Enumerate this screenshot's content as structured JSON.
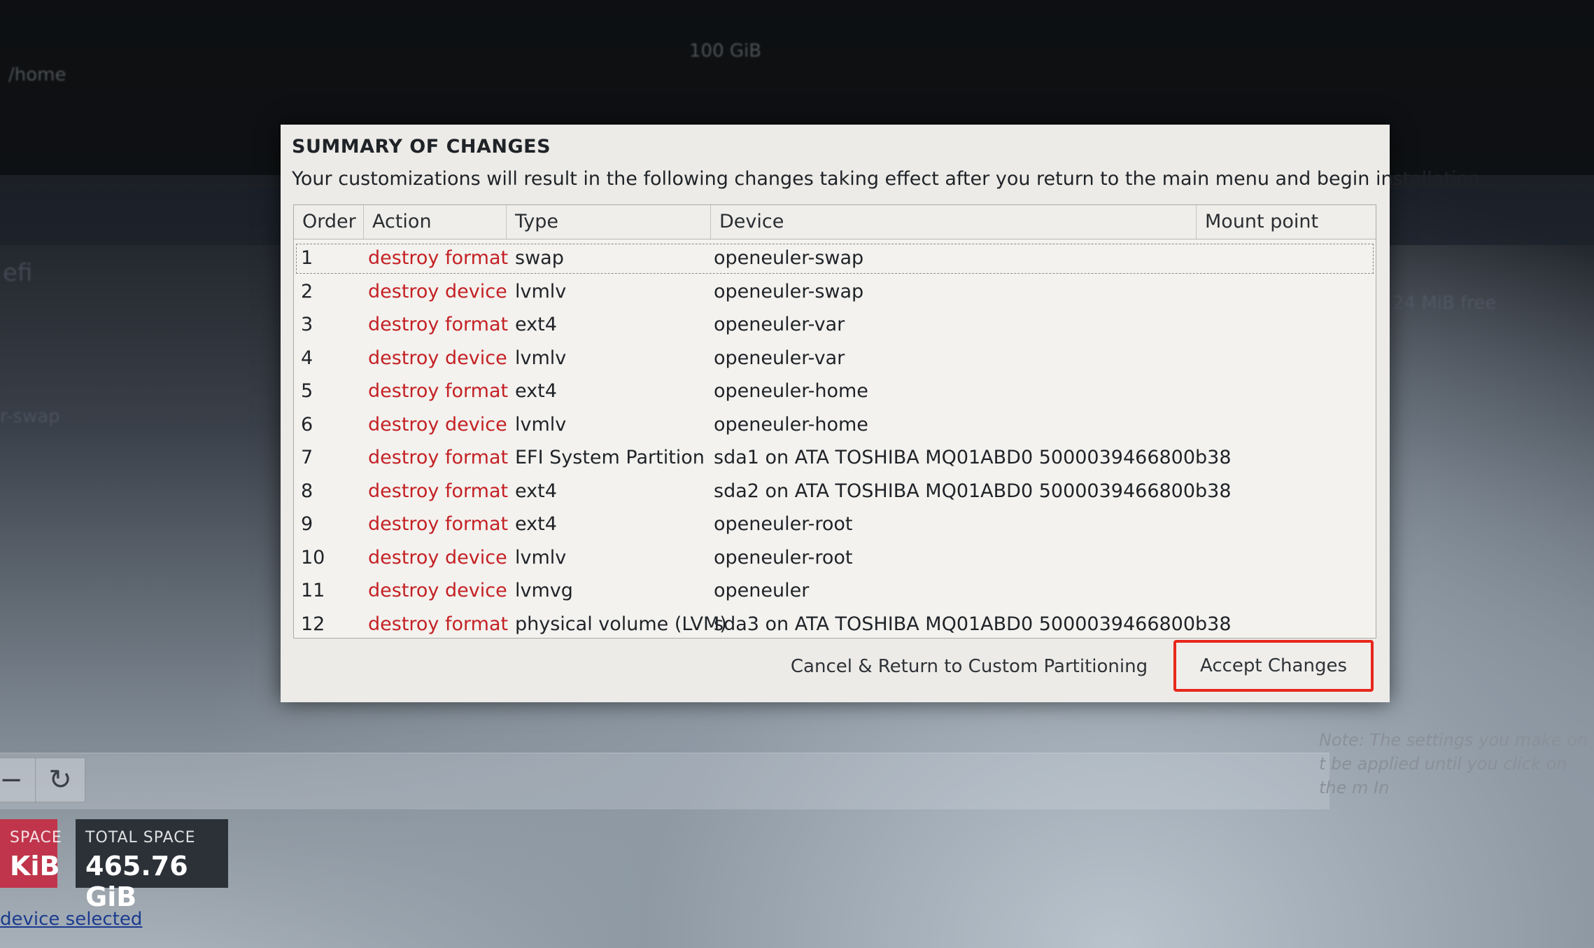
{
  "background": {
    "blurred_home": "/home",
    "blurred_size": "100 GiB",
    "blurred_efi": "efi",
    "blurred_swap": "r-swap",
    "blurred_free": "24 MiB free",
    "note": "Note:  The settings you make on t be applied until you click on the m In",
    "refresh_icon": "refresh-icon",
    "available_space": {
      "label": "SPACE",
      "value": "KiB",
      "color": "#c0354b"
    },
    "total_space": {
      "label": "TOTAL SPACE",
      "value": "465.76 GiB",
      "color": "#2c3138"
    },
    "device_link": "device selected"
  },
  "dialog": {
    "title": "SUMMARY OF CHANGES",
    "description": "Your customizations will result in the following changes taking effect after you return to the main menu and begin installation:",
    "columns": {
      "order": "Order",
      "action": "Action",
      "type": "Type",
      "device": "Device",
      "mount_point": "Mount point"
    },
    "rows": [
      {
        "order": "1",
        "action": "destroy format",
        "type": "swap",
        "device": "openeuler-swap",
        "mount_point": ""
      },
      {
        "order": "2",
        "action": "destroy device",
        "type": "lvmlv",
        "device": "openeuler-swap",
        "mount_point": ""
      },
      {
        "order": "3",
        "action": "destroy format",
        "type": "ext4",
        "device": "openeuler-var",
        "mount_point": ""
      },
      {
        "order": "4",
        "action": "destroy device",
        "type": "lvmlv",
        "device": "openeuler-var",
        "mount_point": ""
      },
      {
        "order": "5",
        "action": "destroy format",
        "type": "ext4",
        "device": "openeuler-home",
        "mount_point": ""
      },
      {
        "order": "6",
        "action": "destroy device",
        "type": "lvmlv",
        "device": "openeuler-home",
        "mount_point": ""
      },
      {
        "order": "7",
        "action": "destroy format",
        "type": "EFI System Partition",
        "device": "sda1 on ATA TOSHIBA MQ01ABD0 5000039466800b38",
        "mount_point": ""
      },
      {
        "order": "8",
        "action": "destroy format",
        "type": "ext4",
        "device": "sda2 on ATA TOSHIBA MQ01ABD0 5000039466800b38",
        "mount_point": ""
      },
      {
        "order": "9",
        "action": "destroy format",
        "type": "ext4",
        "device": "openeuler-root",
        "mount_point": ""
      },
      {
        "order": "10",
        "action": "destroy device",
        "type": "lvmlv",
        "device": "openeuler-root",
        "mount_point": ""
      },
      {
        "order": "11",
        "action": "destroy device",
        "type": "lvmvg",
        "device": "openeuler",
        "mount_point": ""
      },
      {
        "order": "12",
        "action": "destroy format",
        "type": "physical volume (LVM)",
        "device": "sda3 on ATA TOSHIBA MQ01ABD0 5000039466800b38",
        "mount_point": ""
      }
    ],
    "action_color": "#c42124",
    "cancel_button": "Cancel & Return to Custom Partitioning",
    "accept_button": "Accept Changes",
    "accept_highlight_color": "#e8271c"
  }
}
